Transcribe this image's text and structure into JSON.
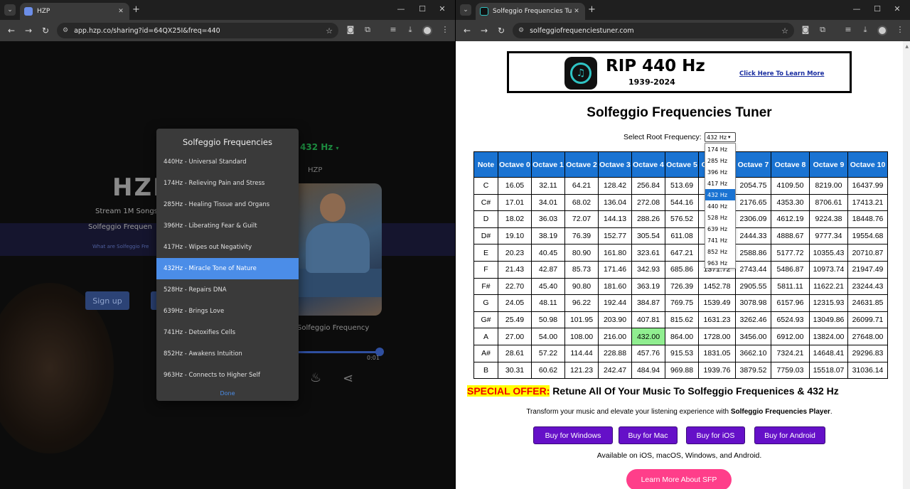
{
  "left_window": {
    "tab_title": "HZP",
    "url": "app.hzp.co/sharing?id=64QX25I&freq=440",
    "page": {
      "logo_text": "HZP",
      "stream_text": "Stream 1M Songs",
      "solfeggio_text": "Solfeggio Frequen",
      "what_link": "What are Solfeggio Fre",
      "signup_label": "Sign up",
      "freq_selector": "432 Hz",
      "app_name_small": "HZP",
      "caption": "Solfeggio Frequency",
      "time": "0:01"
    },
    "modal": {
      "title": "Solfeggio Frequencies",
      "items": [
        "440Hz - Universal Standard",
        "174Hz - Relieving Pain and Stress",
        "285Hz - Healing Tissue and Organs",
        "396Hz - Liberating Fear & Guilt",
        "417Hz - Wipes out Negativity",
        "432Hz - Miracle Tone of Nature",
        "528Hz - Repairs DNA",
        "639Hz - Brings Love",
        "741Hz - Detoxifies Cells",
        "852Hz - Awakens Intuition",
        "963Hz - Connects to Higher Self"
      ],
      "selected_index": 5,
      "done_label": "Done"
    }
  },
  "right_window": {
    "tab_title": "Solfeggio Frequencies Tuner",
    "url": "solfeggiofrequenciestuner.com",
    "banner": {
      "title": "RIP 440 Hz",
      "years": "1939-2024",
      "link": "Click Here To Learn More"
    },
    "page_title": "Solfeggio Frequencies Tuner",
    "root_label": "Select Root Frequency:",
    "root_value": "432 Hz",
    "dropdown_options": [
      "174 Hz",
      "285 Hz",
      "396 Hz",
      "417 Hz",
      "432 Hz",
      "440 Hz",
      "528 Hz",
      "639 Hz",
      "741 Hz",
      "852 Hz",
      "963 Hz"
    ],
    "dropdown_selected_index": 4,
    "table": {
      "headers": [
        "Note",
        "Octave 0",
        "Octave 1",
        "Octave 2",
        "Octave 3",
        "Octave 4",
        "Octave 5",
        "Octave 6",
        "Octave 7",
        "Octave 8",
        "Octave 9",
        "Octave 10"
      ],
      "rows": [
        [
          "C",
          "16.05",
          "32.11",
          "64.21",
          "128.42",
          "256.84",
          "513.69",
          "",
          "2054.75",
          "4109.50",
          "8219.00",
          "16437.99"
        ],
        [
          "C#",
          "17.01",
          "34.01",
          "68.02",
          "136.04",
          "272.08",
          "544.16",
          "",
          "2176.65",
          "4353.30",
          "8706.61",
          "17413.21"
        ],
        [
          "D",
          "18.02",
          "36.03",
          "72.07",
          "144.13",
          "288.26",
          "576.52",
          "",
          "2306.09",
          "4612.19",
          "9224.38",
          "18448.76"
        ],
        [
          "D#",
          "19.10",
          "38.19",
          "76.39",
          "152.77",
          "305.54",
          "611.08",
          "",
          "2444.33",
          "4888.67",
          "9777.34",
          "19554.68"
        ],
        [
          "E",
          "20.23",
          "40.45",
          "80.90",
          "161.80",
          "323.61",
          "647.21",
          "",
          "2588.86",
          "5177.72",
          "10355.43",
          "20710.87"
        ],
        [
          "F",
          "21.43",
          "42.87",
          "85.73",
          "171.46",
          "342.93",
          "685.86",
          "1371.72",
          "2743.44",
          "5486.87",
          "10973.74",
          "21947.49"
        ],
        [
          "F#",
          "22.70",
          "45.40",
          "90.80",
          "181.60",
          "363.19",
          "726.39",
          "1452.78",
          "2905.55",
          "5811.11",
          "11622.21",
          "23244.43"
        ],
        [
          "G",
          "24.05",
          "48.11",
          "96.22",
          "192.44",
          "384.87",
          "769.75",
          "1539.49",
          "3078.98",
          "6157.96",
          "12315.93",
          "24631.85"
        ],
        [
          "G#",
          "25.49",
          "50.98",
          "101.95",
          "203.90",
          "407.81",
          "815.62",
          "1631.23",
          "3262.46",
          "6524.93",
          "13049.86",
          "26099.71"
        ],
        [
          "A",
          "27.00",
          "54.00",
          "108.00",
          "216.00",
          "432.00",
          "864.00",
          "1728.00",
          "3456.00",
          "6912.00",
          "13824.00",
          "27648.00"
        ],
        [
          "A#",
          "28.61",
          "57.22",
          "114.44",
          "228.88",
          "457.76",
          "915.53",
          "1831.05",
          "3662.10",
          "7324.21",
          "14648.41",
          "29296.83"
        ],
        [
          "B",
          "30.31",
          "60.62",
          "121.23",
          "242.47",
          "484.94",
          "969.88",
          "1939.76",
          "3879.52",
          "7759.03",
          "15518.07",
          "31036.14"
        ]
      ],
      "highlight": {
        "row": 9,
        "col": 5
      }
    },
    "offer_tag": "SPECIAL OFFER:",
    "offer_text": " Retune All Of Your Music To Solfeggio Frequenices & 432 Hz",
    "transform_text": "Transform your music and elevate your listening experience with ",
    "transform_bold": "Solfeggio Frequencies Player",
    "transform_end": ".",
    "buy_buttons": [
      "Buy for Windows",
      "Buy for Mac",
      "Buy for iOS",
      "Buy for Android"
    ],
    "available_text": "Available on iOS, macOS, Windows, and Android.",
    "learn_more": "Learn More About SFP"
  },
  "colors": {
    "accent_blue": "#1a73d2",
    "highlight_green": "#90ee90",
    "buy_purple": "#6510c8",
    "learn_pink": "#ff3e8a",
    "modal_selected": "#4b8de8"
  }
}
